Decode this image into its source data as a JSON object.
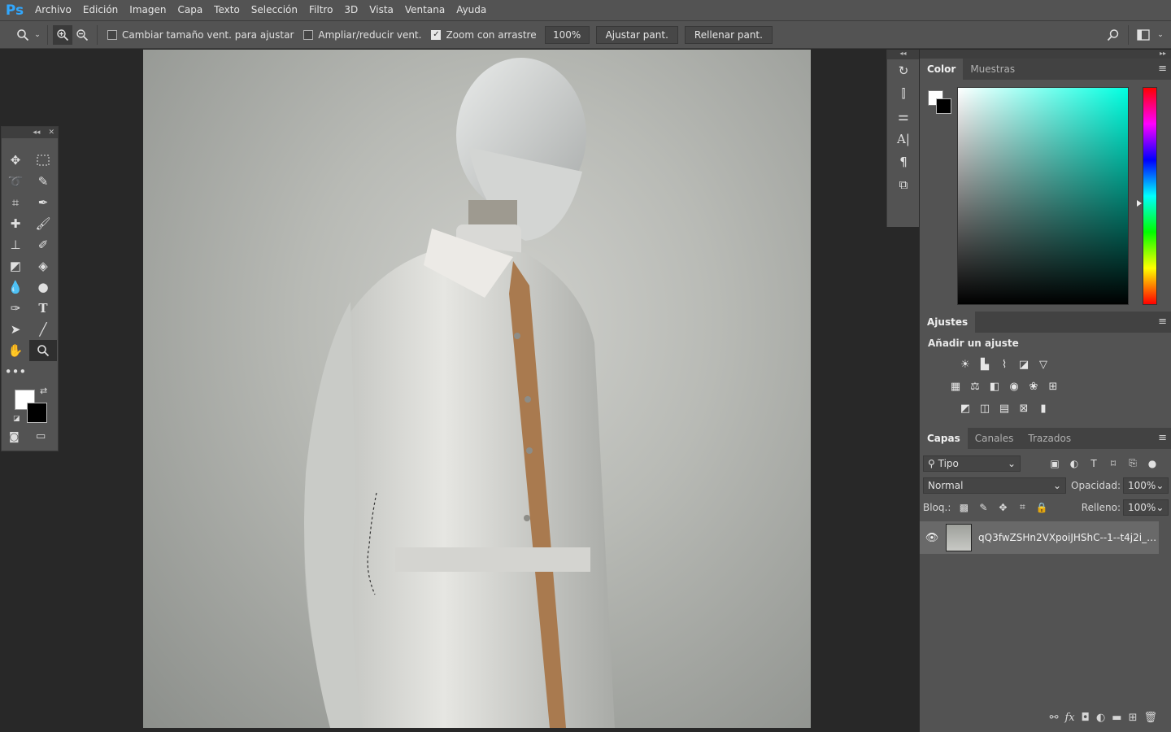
{
  "app": {
    "logo": "Ps"
  },
  "menu": [
    "Archivo",
    "Edición",
    "Imagen",
    "Capa",
    "Texto",
    "Selección",
    "Filtro",
    "3D",
    "Vista",
    "Ventana",
    "Ayuda"
  ],
  "options": {
    "resize_windows_label": "Cambiar tamaño vent. para ajustar",
    "zoom_all_label": "Ampliar/reducir vent.",
    "scrubby_zoom_label": "Zoom con arrastre",
    "zoom_value": "100%",
    "fit_screen_label": "Ajustar pant.",
    "fill_screen_label": "Rellenar pant."
  },
  "color_panel": {
    "tabs": [
      "Color",
      "Muestras"
    ]
  },
  "adjustments_panel": {
    "tab": "Ajustes",
    "subtitle": "Añadir un ajuste"
  },
  "layers_panel": {
    "tabs": [
      "Capas",
      "Canales",
      "Trazados"
    ],
    "filter_kind": "Tipo",
    "blend_mode": "Normal",
    "opacity_label": "Opacidad:",
    "opacity_value": "100%",
    "lock_label": "Bloq.:",
    "fill_label": "Relleno:",
    "fill_value": "100%",
    "layer_name": "qQ3fwZSHn2VXpoiJHShC--1--t4j2i_2x-r..."
  },
  "colors": {
    "accent": "#31a8ff",
    "panel": "#535353",
    "dark": "#282828"
  }
}
